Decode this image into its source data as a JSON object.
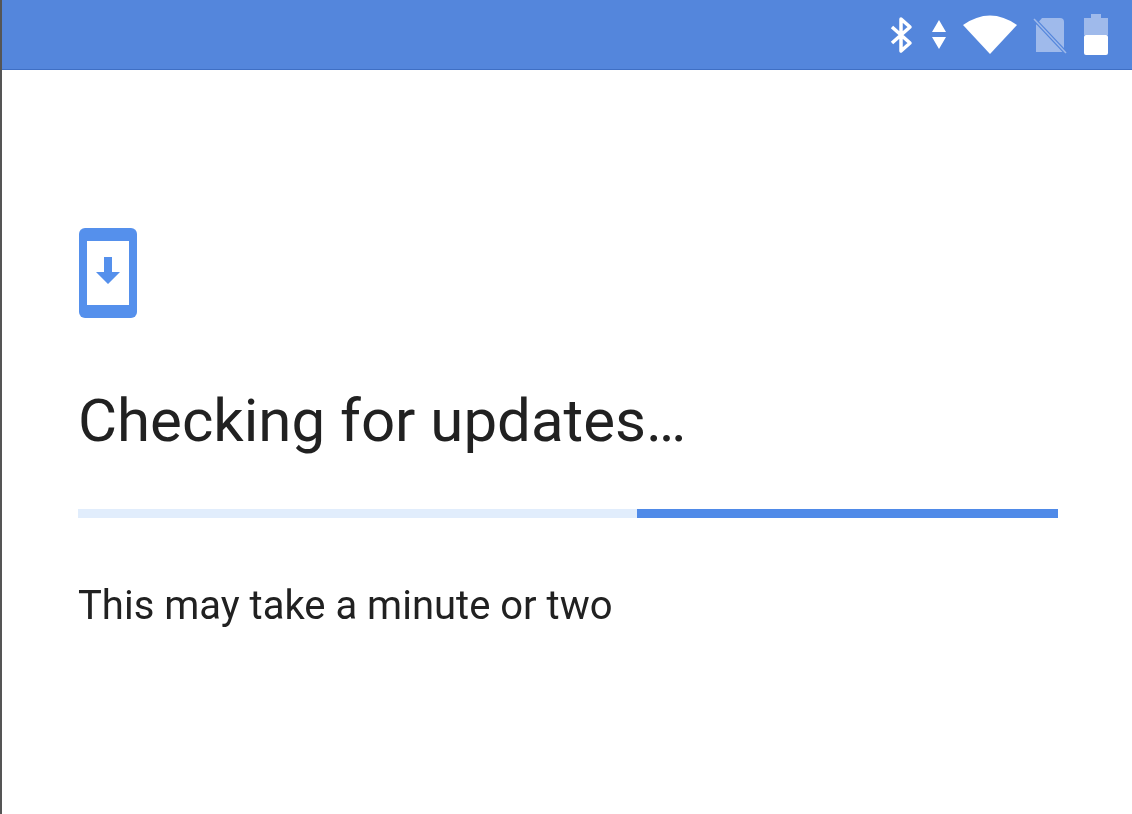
{
  "title": "Checking for updates…",
  "progress": {
    "indeterminate": true
  },
  "subtitle": "This may take a minute or two"
}
